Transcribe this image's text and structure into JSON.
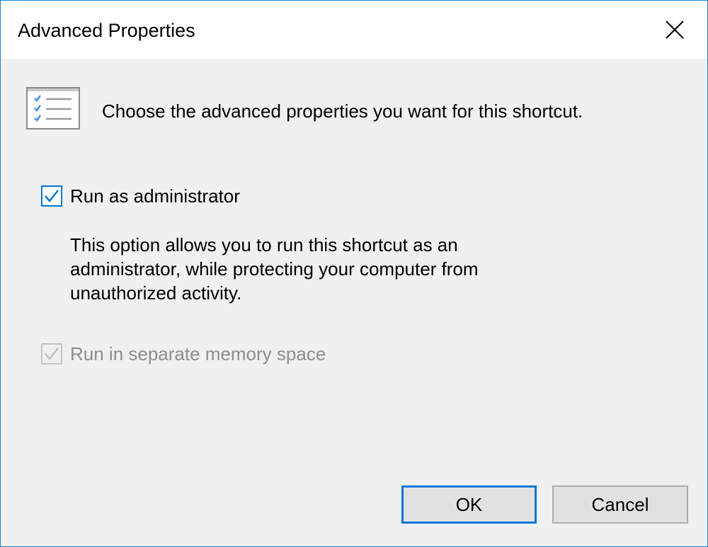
{
  "window": {
    "title": "Advanced Properties",
    "accent_color": "#0078d7"
  },
  "header": {
    "icon": "checklist-icon",
    "text": "Choose the advanced properties you want for this shortcut."
  },
  "options": {
    "run_as_admin": {
      "label": "Run as administrator",
      "checked": true,
      "enabled": true,
      "description_lines": [
        "This option allows you to run this shortcut as an",
        "administrator, while protecting your computer from",
        "unauthorized activity."
      ]
    },
    "separate_memory": {
      "label": "Run in separate memory space",
      "checked": true,
      "enabled": false
    }
  },
  "buttons": {
    "ok": "OK",
    "cancel": "Cancel"
  }
}
